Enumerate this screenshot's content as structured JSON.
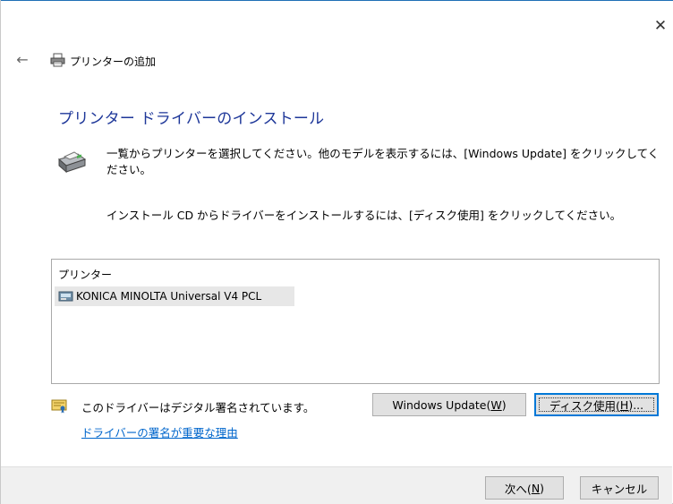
{
  "window": {
    "close_glyph": "✕"
  },
  "nav": {
    "back_glyph": "←",
    "title": "プリンターの追加"
  },
  "main": {
    "heading": "プリンター ドライバーのインストール",
    "instruction1": "一覧からプリンターを選択してください。他のモデルを表示するには、[Windows Update] をクリックしてください。",
    "instruction2": "インストール CD からドライバーをインストールするには、[ディスク使用] をクリックしてください。"
  },
  "printer_list": {
    "header": "プリンター",
    "items": [
      {
        "label": "KONICA MINOLTA Universal V4 PCL",
        "selected": true
      }
    ]
  },
  "signature": {
    "status": "このドライバーはデジタル署名されています。",
    "link": "ドライバーの署名が重要な理由"
  },
  "buttons": {
    "windows_update": {
      "label": "Windows Update(",
      "mnemonic": "W",
      "suffix": ")"
    },
    "have_disk": {
      "label": "ディスク使用(",
      "mnemonic": "H",
      "suffix": ")..."
    },
    "next": {
      "label": "次へ(",
      "mnemonic": "N",
      "suffix": ")"
    },
    "cancel": {
      "label": "キャンセル"
    }
  },
  "colors": {
    "heading": "#1e3799",
    "link": "#0066cc",
    "accent": "#0078d7"
  },
  "icons": [
    "close-icon",
    "back-arrow-icon",
    "printer-icon",
    "certificate-icon"
  ]
}
